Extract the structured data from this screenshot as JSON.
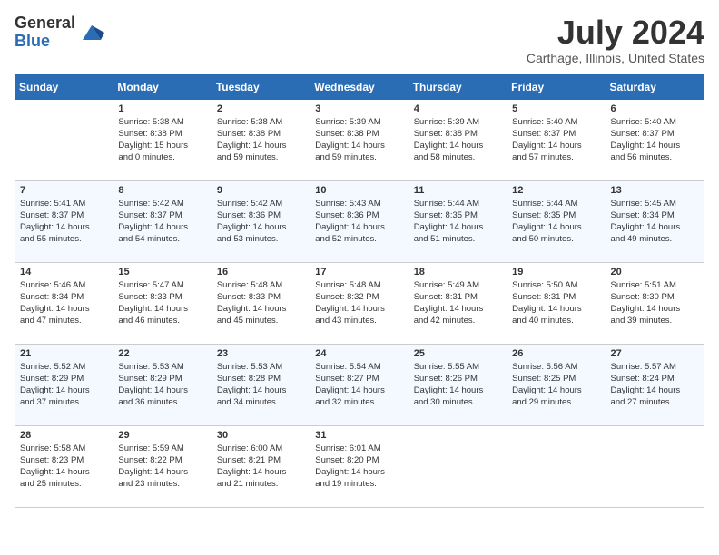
{
  "header": {
    "logo_general": "General",
    "logo_blue": "Blue",
    "month_year": "July 2024",
    "location": "Carthage, Illinois, United States"
  },
  "days_of_week": [
    "Sunday",
    "Monday",
    "Tuesday",
    "Wednesday",
    "Thursday",
    "Friday",
    "Saturday"
  ],
  "weeks": [
    [
      {
        "day": "",
        "content": ""
      },
      {
        "day": "1",
        "content": "Sunrise: 5:38 AM\nSunset: 8:38 PM\nDaylight: 15 hours\nand 0 minutes."
      },
      {
        "day": "2",
        "content": "Sunrise: 5:38 AM\nSunset: 8:38 PM\nDaylight: 14 hours\nand 59 minutes."
      },
      {
        "day": "3",
        "content": "Sunrise: 5:39 AM\nSunset: 8:38 PM\nDaylight: 14 hours\nand 59 minutes."
      },
      {
        "day": "4",
        "content": "Sunrise: 5:39 AM\nSunset: 8:38 PM\nDaylight: 14 hours\nand 58 minutes."
      },
      {
        "day": "5",
        "content": "Sunrise: 5:40 AM\nSunset: 8:37 PM\nDaylight: 14 hours\nand 57 minutes."
      },
      {
        "day": "6",
        "content": "Sunrise: 5:40 AM\nSunset: 8:37 PM\nDaylight: 14 hours\nand 56 minutes."
      }
    ],
    [
      {
        "day": "7",
        "content": "Sunrise: 5:41 AM\nSunset: 8:37 PM\nDaylight: 14 hours\nand 55 minutes."
      },
      {
        "day": "8",
        "content": "Sunrise: 5:42 AM\nSunset: 8:37 PM\nDaylight: 14 hours\nand 54 minutes."
      },
      {
        "day": "9",
        "content": "Sunrise: 5:42 AM\nSunset: 8:36 PM\nDaylight: 14 hours\nand 53 minutes."
      },
      {
        "day": "10",
        "content": "Sunrise: 5:43 AM\nSunset: 8:36 PM\nDaylight: 14 hours\nand 52 minutes."
      },
      {
        "day": "11",
        "content": "Sunrise: 5:44 AM\nSunset: 8:35 PM\nDaylight: 14 hours\nand 51 minutes."
      },
      {
        "day": "12",
        "content": "Sunrise: 5:44 AM\nSunset: 8:35 PM\nDaylight: 14 hours\nand 50 minutes."
      },
      {
        "day": "13",
        "content": "Sunrise: 5:45 AM\nSunset: 8:34 PM\nDaylight: 14 hours\nand 49 minutes."
      }
    ],
    [
      {
        "day": "14",
        "content": "Sunrise: 5:46 AM\nSunset: 8:34 PM\nDaylight: 14 hours\nand 47 minutes."
      },
      {
        "day": "15",
        "content": "Sunrise: 5:47 AM\nSunset: 8:33 PM\nDaylight: 14 hours\nand 46 minutes."
      },
      {
        "day": "16",
        "content": "Sunrise: 5:48 AM\nSunset: 8:33 PM\nDaylight: 14 hours\nand 45 minutes."
      },
      {
        "day": "17",
        "content": "Sunrise: 5:48 AM\nSunset: 8:32 PM\nDaylight: 14 hours\nand 43 minutes."
      },
      {
        "day": "18",
        "content": "Sunrise: 5:49 AM\nSunset: 8:31 PM\nDaylight: 14 hours\nand 42 minutes."
      },
      {
        "day": "19",
        "content": "Sunrise: 5:50 AM\nSunset: 8:31 PM\nDaylight: 14 hours\nand 40 minutes."
      },
      {
        "day": "20",
        "content": "Sunrise: 5:51 AM\nSunset: 8:30 PM\nDaylight: 14 hours\nand 39 minutes."
      }
    ],
    [
      {
        "day": "21",
        "content": "Sunrise: 5:52 AM\nSunset: 8:29 PM\nDaylight: 14 hours\nand 37 minutes."
      },
      {
        "day": "22",
        "content": "Sunrise: 5:53 AM\nSunset: 8:29 PM\nDaylight: 14 hours\nand 36 minutes."
      },
      {
        "day": "23",
        "content": "Sunrise: 5:53 AM\nSunset: 8:28 PM\nDaylight: 14 hours\nand 34 minutes."
      },
      {
        "day": "24",
        "content": "Sunrise: 5:54 AM\nSunset: 8:27 PM\nDaylight: 14 hours\nand 32 minutes."
      },
      {
        "day": "25",
        "content": "Sunrise: 5:55 AM\nSunset: 8:26 PM\nDaylight: 14 hours\nand 30 minutes."
      },
      {
        "day": "26",
        "content": "Sunrise: 5:56 AM\nSunset: 8:25 PM\nDaylight: 14 hours\nand 29 minutes."
      },
      {
        "day": "27",
        "content": "Sunrise: 5:57 AM\nSunset: 8:24 PM\nDaylight: 14 hours\nand 27 minutes."
      }
    ],
    [
      {
        "day": "28",
        "content": "Sunrise: 5:58 AM\nSunset: 8:23 PM\nDaylight: 14 hours\nand 25 minutes."
      },
      {
        "day": "29",
        "content": "Sunrise: 5:59 AM\nSunset: 8:22 PM\nDaylight: 14 hours\nand 23 minutes."
      },
      {
        "day": "30",
        "content": "Sunrise: 6:00 AM\nSunset: 8:21 PM\nDaylight: 14 hours\nand 21 minutes."
      },
      {
        "day": "31",
        "content": "Sunrise: 6:01 AM\nSunset: 8:20 PM\nDaylight: 14 hours\nand 19 minutes."
      },
      {
        "day": "",
        "content": ""
      },
      {
        "day": "",
        "content": ""
      },
      {
        "day": "",
        "content": ""
      }
    ]
  ]
}
